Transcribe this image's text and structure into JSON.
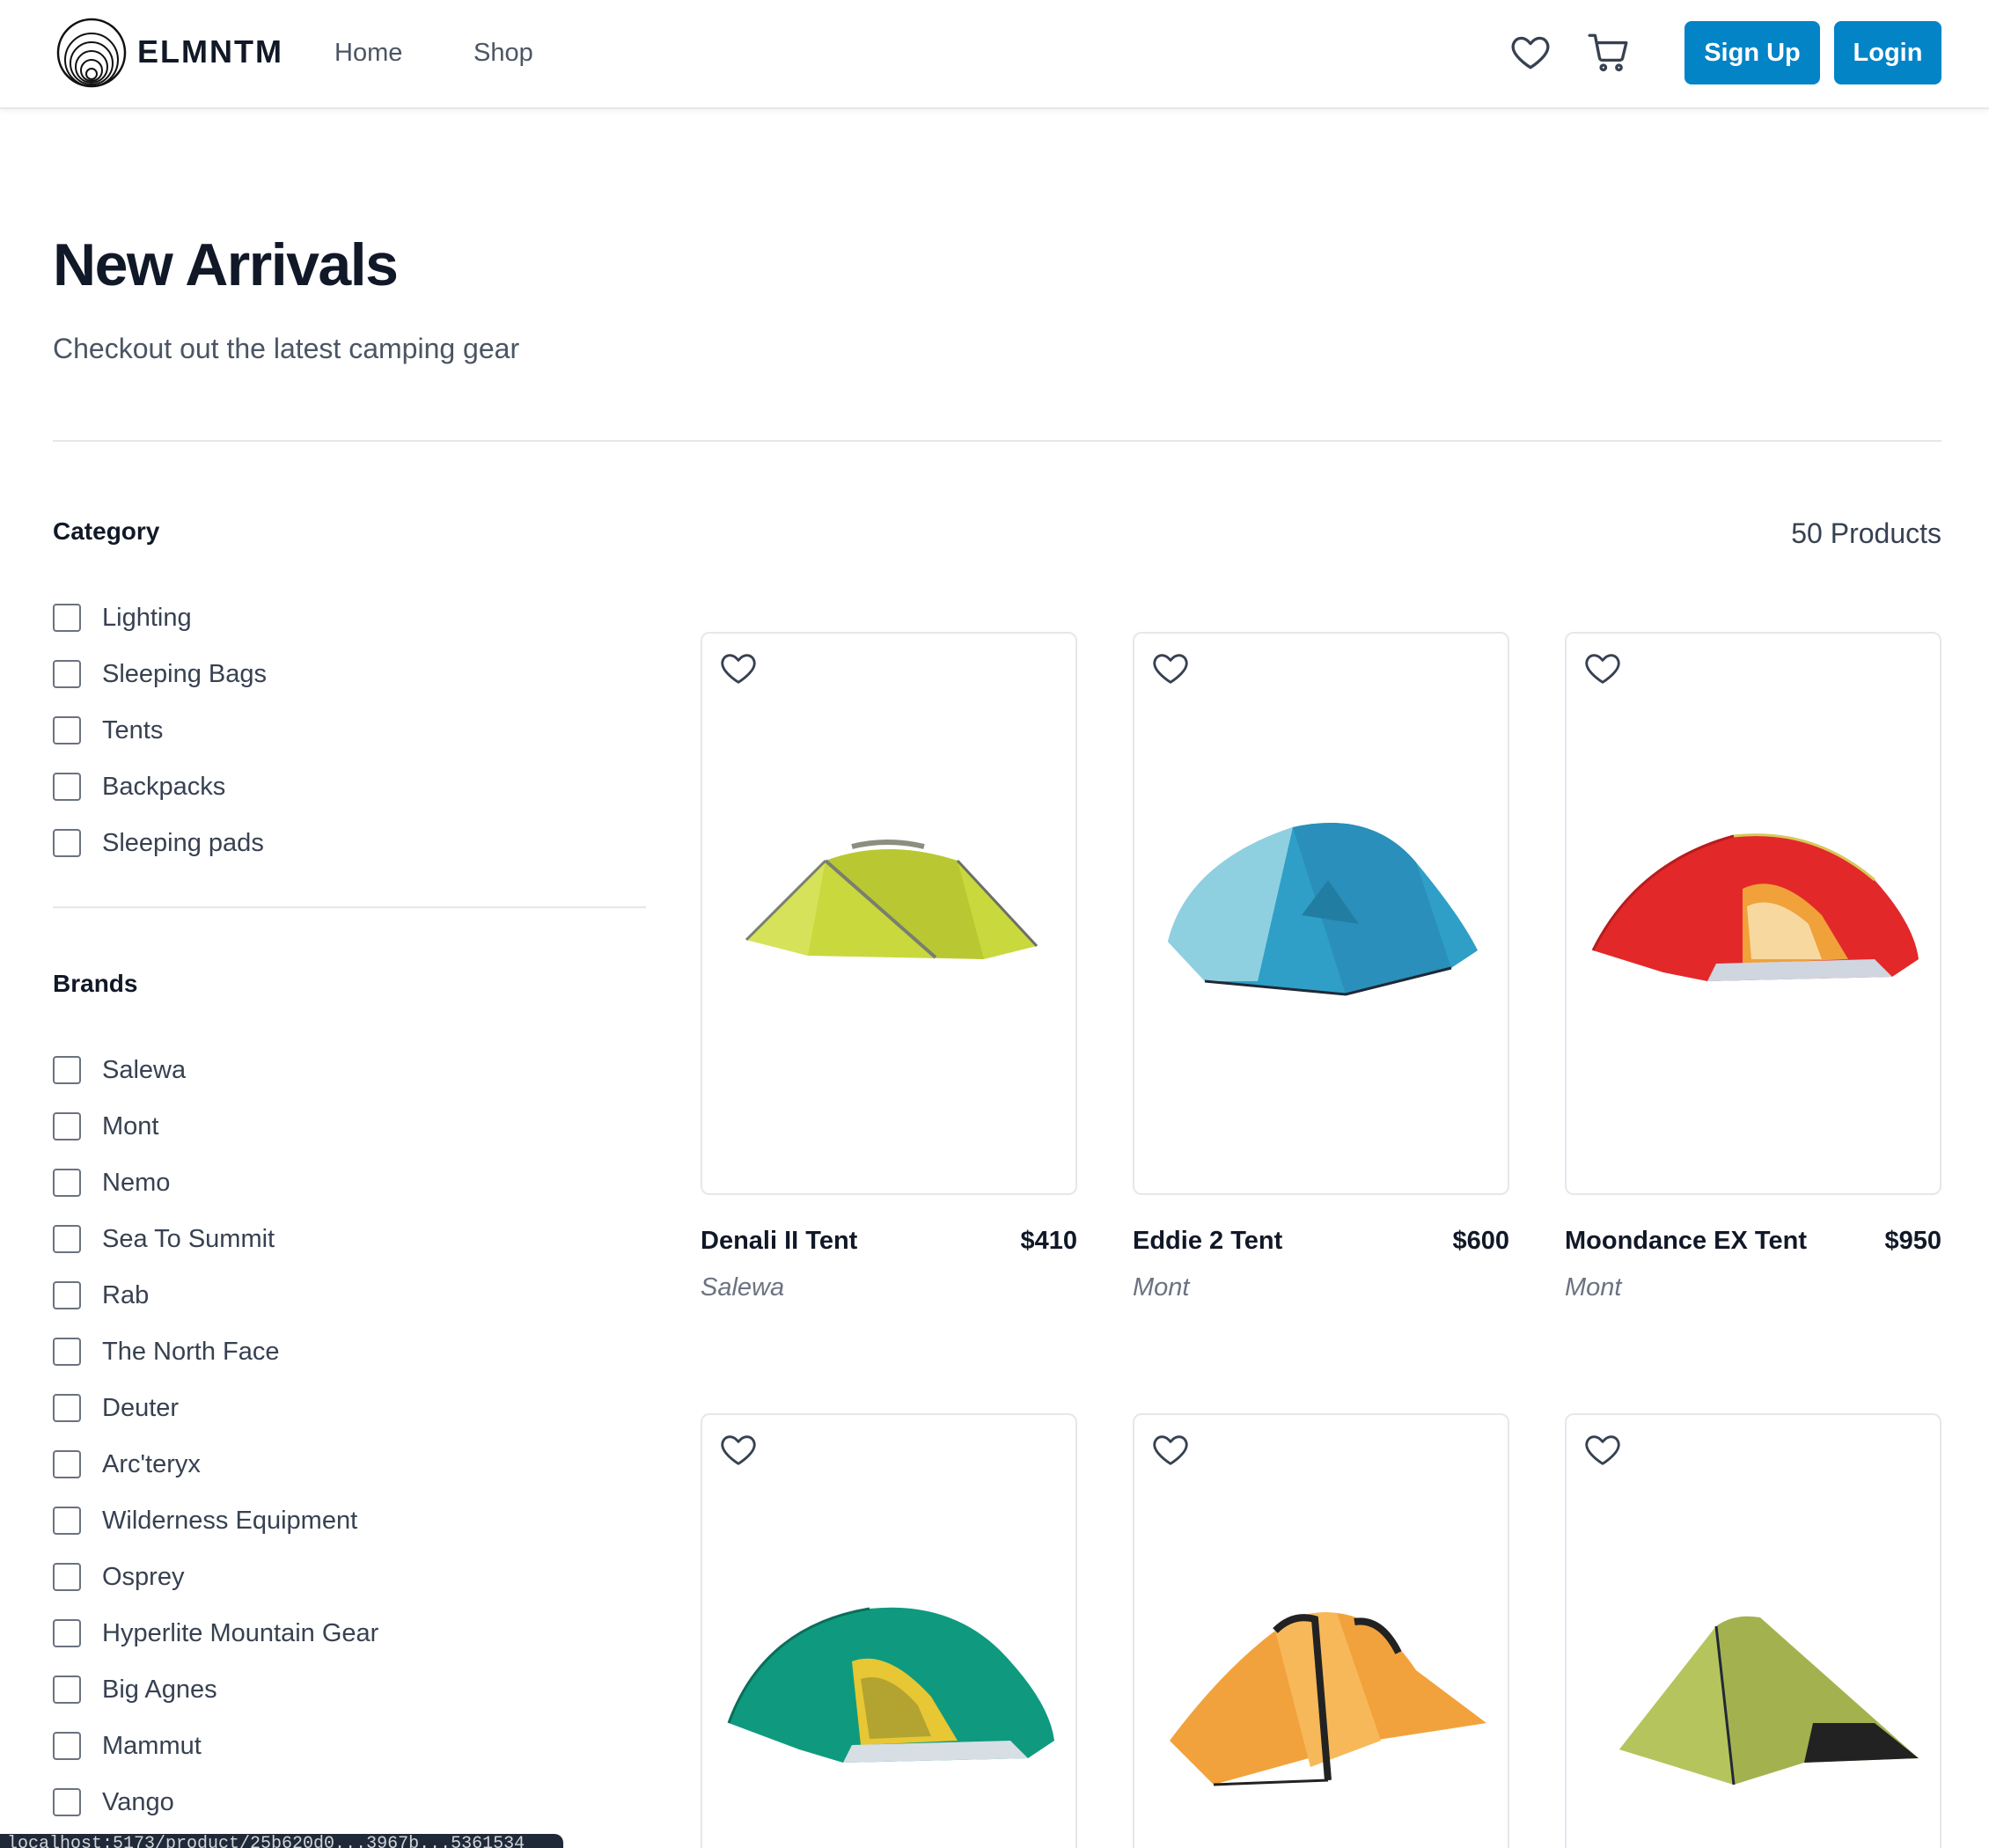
{
  "header": {
    "brand": "ELMNTM",
    "nav": [
      {
        "label": "Home"
      },
      {
        "label": "Shop"
      }
    ],
    "icons": [
      "heart-icon",
      "cart-icon"
    ],
    "signup_label": "Sign Up",
    "login_label": "Login",
    "accent_color": "#0284c7"
  },
  "page": {
    "title": "New Arrivals",
    "subtitle": "Checkout out the latest camping gear"
  },
  "filters": {
    "category": {
      "title": "Category",
      "items": [
        "Lighting",
        "Sleeping Bags",
        "Tents",
        "Backpacks",
        "Sleeping pads"
      ]
    },
    "brands": {
      "title": "Brands",
      "items": [
        "Salewa",
        "Mont",
        "Nemo",
        "Sea To Summit",
        "Rab",
        "The North Face",
        "Deuter",
        "Arc'teryx",
        "Wilderness Equipment",
        "Osprey",
        "Hyperlite Mountain Gear",
        "Big Agnes",
        "Mammut",
        "Vango"
      ]
    }
  },
  "products_count": "50 Products",
  "products": [
    {
      "name": "Denali II Tent",
      "price": "$410",
      "brand": "Salewa",
      "color": "#c6d63a"
    },
    {
      "name": "Eddie 2 Tent",
      "price": "$600",
      "brand": "Mont",
      "color": "#2e9fc6"
    },
    {
      "name": "Moondance EX Tent",
      "price": "$950",
      "brand": "Mont",
      "color": "#e3282a"
    },
    {
      "name": "",
      "price": "",
      "brand": "",
      "color": "#0f9a7f"
    },
    {
      "name": "",
      "price": "",
      "brand": "",
      "color": "#f2a23c"
    },
    {
      "name": "",
      "price": "",
      "brand": "",
      "color": "#9fb04c"
    }
  ],
  "status_bar": "localhost:5173/product/25b620d0...3967b...5361534"
}
